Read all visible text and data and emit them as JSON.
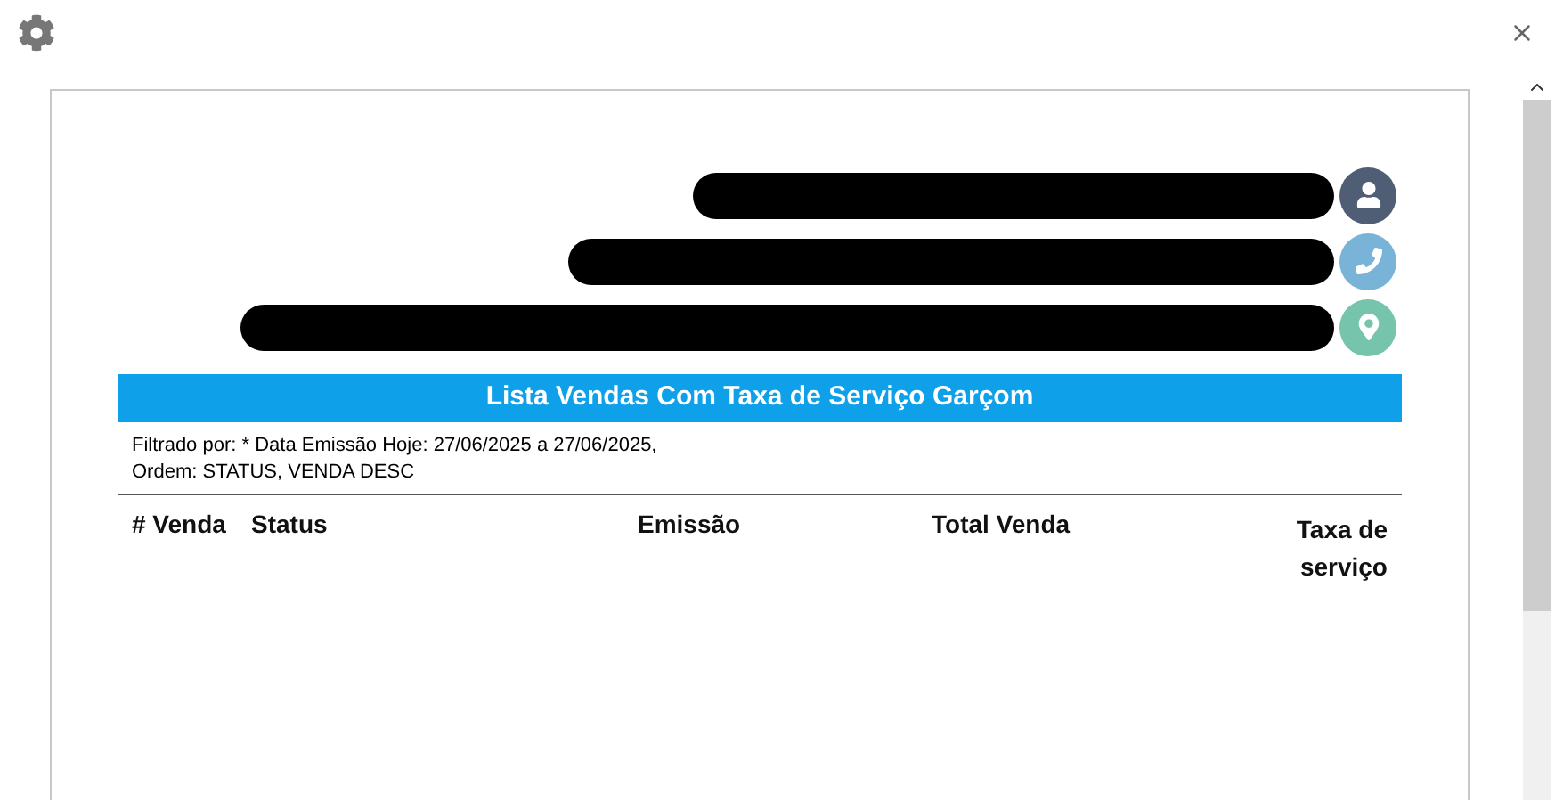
{
  "contact_rows": [
    {
      "kind": "person"
    },
    {
      "kind": "phone"
    },
    {
      "kind": "location"
    }
  ],
  "report": {
    "title": "Lista Vendas Com Taxa de Serviço Garçom",
    "filter": "Filtrado por: * Data Emissão Hoje: 27/06/2025 a 27/06/2025,",
    "order": "Ordem: STATUS, VENDA DESC"
  },
  "table": {
    "columns": [
      "# Venda",
      "Status",
      "Emissão",
      "Total Venda",
      "Taxa de serviço"
    ]
  }
}
